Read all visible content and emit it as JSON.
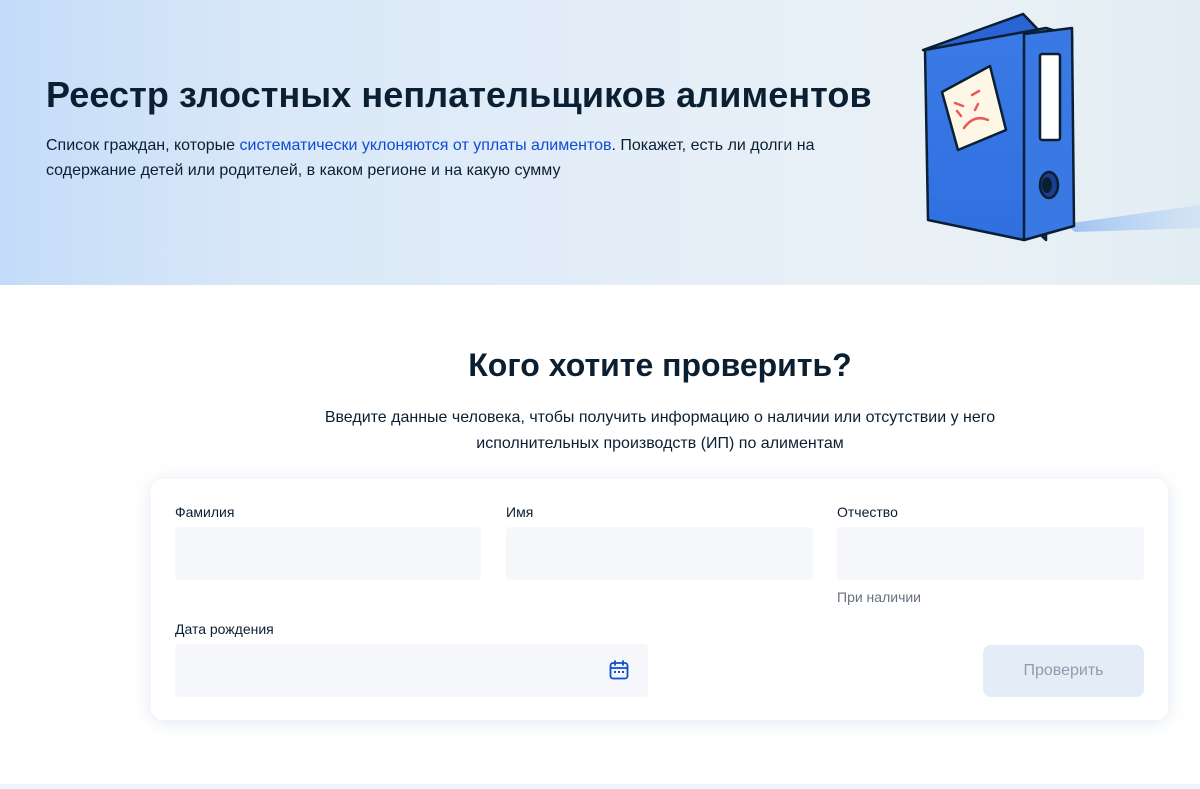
{
  "hero": {
    "title": "Реестр злостных неплательщиков алиментов",
    "desc_before": "Список граждан, которые ",
    "desc_link": "систематически уклоняются от уплаты алиментов",
    "desc_after": ". Покажет, есть ли долги на содержание детей или родителей, в каком регионе и на какую сумму",
    "illustration": "blue-binder-with-sad-sticky-note"
  },
  "form_section": {
    "title": "Кого хотите проверить?",
    "subtitle": "Введите данные человека, чтобы получить информацию о наличии или отсутствии у него исполнительных производств (ИП) по алиментам"
  },
  "form": {
    "surname": {
      "label": "Фамилия",
      "value": ""
    },
    "name": {
      "label": "Имя",
      "value": ""
    },
    "patronymic": {
      "label": "Отчество",
      "value": "",
      "hint": "При наличии"
    },
    "birthdate": {
      "label": "Дата рождения",
      "value": "",
      "icon": "calendar-icon"
    },
    "submit_label": "Проверить"
  },
  "colors": {
    "link": "#0d4cd3",
    "input_bg": "#f5f7fb",
    "button_disabled_bg": "#e4ecf7",
    "button_disabled_text": "#8d9db0",
    "binder_blue": "#3b7be6"
  }
}
